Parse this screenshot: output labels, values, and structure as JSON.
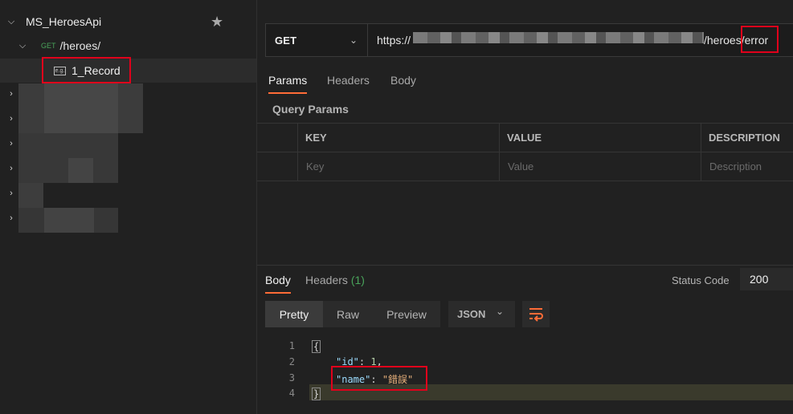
{
  "sidebar": {
    "collection_name": "MS_HeroesApi",
    "request": {
      "method": "GET",
      "path": "/heroes/"
    },
    "example_label": "1_Record",
    "example_icon_text": "e.g."
  },
  "request": {
    "method": "GET",
    "url_prefix": "https://",
    "url_suffix": "/heroes/error",
    "tabs": [
      "Params",
      "Headers",
      "Body"
    ],
    "active_tab": "Params",
    "section_title": "Query Params",
    "table": {
      "headers": [
        "KEY",
        "VALUE",
        "DESCRIPTION"
      ],
      "placeholders": [
        "Key",
        "Value",
        "Description"
      ]
    }
  },
  "response": {
    "tabs": {
      "body": "Body",
      "headers": "Headers",
      "headers_count": "(1)"
    },
    "status_label": "Status Code",
    "status_value": "200",
    "view_modes": [
      "Pretty",
      "Raw",
      "Preview"
    ],
    "active_view": "Pretty",
    "format": "JSON",
    "lines": [
      {
        "num": "1",
        "text": "{"
      },
      {
        "num": "2",
        "key": "\"id\"",
        "value": "1"
      },
      {
        "num": "3",
        "key": "\"name\"",
        "value": "\"錯誤\""
      },
      {
        "num": "4",
        "text": "}"
      }
    ]
  },
  "colors": {
    "accent": "#ff6c37",
    "highlight_box": "#e0001b",
    "green": "#49a35a"
  }
}
